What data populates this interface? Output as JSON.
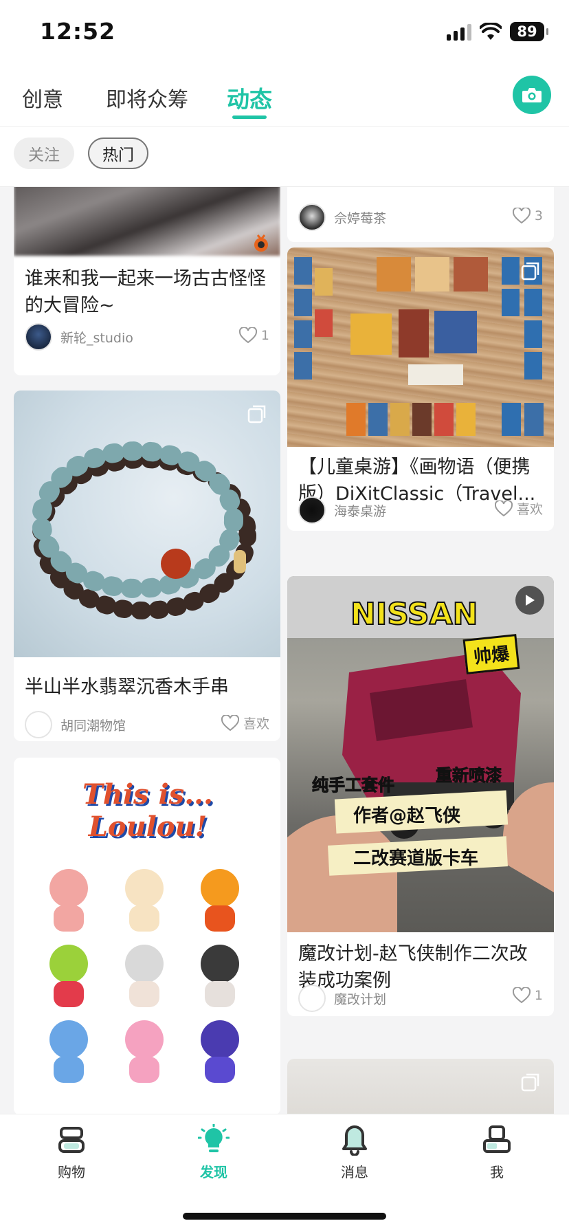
{
  "status_bar": {
    "time": "12:52",
    "battery": "89"
  },
  "top_tabs": [
    {
      "label": "创意",
      "active": false
    },
    {
      "label": "即将众筹",
      "active": false
    },
    {
      "label": "动态",
      "active": true
    }
  ],
  "chips": [
    {
      "label": "关注",
      "active": false
    },
    {
      "label": "热门",
      "active": true
    }
  ],
  "feed": {
    "left": [
      {
        "title": "谁来和我一起来一场古古怪怪的大冒险~",
        "author": "新轮_studio",
        "likes": "1"
      },
      {
        "title": "半山半水翡翠沉香木手串",
        "author": "胡同潮物馆",
        "likes": "喜欢"
      },
      {
        "image_title": "This is... Loulou!"
      }
    ],
    "right": [
      {
        "author": "佘婷莓茶",
        "likes": "3"
      },
      {
        "title": "【儿童桌游】《画物语（便携版）DiXitClassic（Travel...",
        "author": "海泰桌游",
        "likes": "喜欢"
      },
      {
        "title": "魔改计划-赵飞侠制作二次改装成功案例",
        "author": "魔改计划",
        "likes": "1",
        "overlay": {
          "brand": "NISSAN",
          "badge": "帅爆",
          "tag1": "纯手工套件",
          "tag2": "重新喷漆",
          "line1": "作者@赵飞侠",
          "line2": "二改赛道版卡车"
        }
      },
      {}
    ]
  },
  "bottom_nav": [
    {
      "label": "购物",
      "active": false
    },
    {
      "label": "发现",
      "active": true
    },
    {
      "label": "消息",
      "active": false
    },
    {
      "label": "我",
      "active": false
    }
  ],
  "colors": {
    "accent": "#1fc4a6"
  }
}
